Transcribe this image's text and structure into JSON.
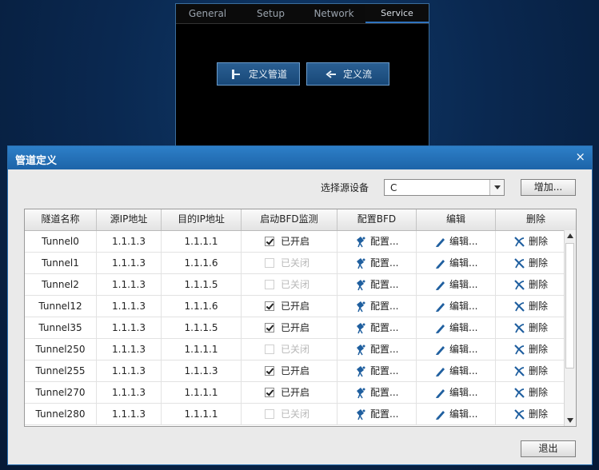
{
  "back_panel": {
    "tabs": [
      {
        "label": "General"
      },
      {
        "label": "Setup"
      },
      {
        "label": "Network"
      },
      {
        "label": "Service",
        "active": true
      }
    ],
    "buttons": {
      "define_tunnel": "定义管道",
      "define_flow": "定义流"
    }
  },
  "dialog": {
    "title": "管道定义",
    "close_label": "×",
    "source_label": "选择源设备",
    "source_value": "C",
    "add_label": "增加...",
    "exit_label": "退出",
    "table": {
      "headers": [
        "隧道名称",
        "源IP地址",
        "目的IP地址",
        "启动BFD监测",
        "配置BFD",
        "编辑",
        "删除"
      ],
      "config_label": "配置...",
      "edit_label": "编辑...",
      "delete_label": "删除",
      "rows": [
        {
          "name": "Tunnel0",
          "src": "1.1.1.3",
          "dst": "1.1.1.1",
          "bfd": true,
          "bfd_text": "已开启"
        },
        {
          "name": "Tunnel1",
          "src": "1.1.1.3",
          "dst": "1.1.1.6",
          "bfd": false,
          "bfd_text": "已关闭"
        },
        {
          "name": "Tunnel2",
          "src": "1.1.1.3",
          "dst": "1.1.1.5",
          "bfd": false,
          "bfd_text": "已关闭"
        },
        {
          "name": "Tunnel12",
          "src": "1.1.1.3",
          "dst": "1.1.1.6",
          "bfd": true,
          "bfd_text": "已开启"
        },
        {
          "name": "Tunnel35",
          "src": "1.1.1.3",
          "dst": "1.1.1.5",
          "bfd": true,
          "bfd_text": "已开启"
        },
        {
          "name": "Tunnel250",
          "src": "1.1.1.3",
          "dst": "1.1.1.1",
          "bfd": false,
          "bfd_text": "已关闭"
        },
        {
          "name": "Tunnel255",
          "src": "1.1.1.3",
          "dst": "1.1.1.3",
          "bfd": true,
          "bfd_text": "已开启"
        },
        {
          "name": "Tunnel270",
          "src": "1.1.1.3",
          "dst": "1.1.1.1",
          "bfd": true,
          "bfd_text": "已开启"
        },
        {
          "name": "Tunnel280",
          "src": "1.1.1.3",
          "dst": "1.1.1.1",
          "bfd": false,
          "bfd_text": "已关闭"
        }
      ]
    }
  },
  "colors": {
    "accent": "#1d64a8",
    "icon_blue": "#1f5f9f",
    "disabled_text": "#b8b8b8"
  }
}
